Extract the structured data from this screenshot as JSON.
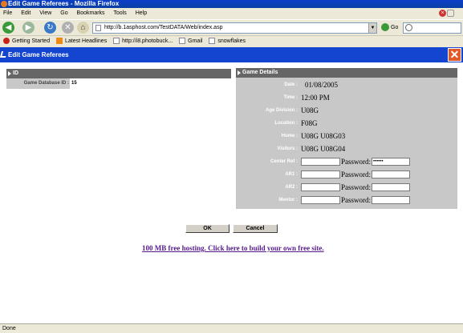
{
  "window": {
    "title": "Edit Game Referees - Mozilla Firefox"
  },
  "menu": [
    "File",
    "Edit",
    "View",
    "Go",
    "Bookmarks",
    "Tools",
    "Help"
  ],
  "nav": {
    "url": "http://b.1asphost.com/TestDATA/Web/index.asp",
    "go_label": "Go"
  },
  "bookmarks": [
    "Getting Started",
    "Latest Headlines",
    "http://i8.photobuck...",
    "Gmail",
    "snowflakes"
  ],
  "page": {
    "header": "Edit Game Referees",
    "id_section": {
      "title": "ID",
      "label": "Game Database ID :",
      "value": "15"
    },
    "details_section": {
      "title": "Game Details",
      "date_label": "Date :",
      "date": "01/08/2005",
      "time_label": "Time :",
      "time": "12:00 PM",
      "age_label": "Age Division :",
      "age": "U08G",
      "location_label": "Location :",
      "location": "F08G",
      "home_label": "Home :",
      "home": "U08G U08G03",
      "visitors_label": "Visitors :",
      "visitors": "U08G U08G04",
      "password_label": "Password:",
      "refs": [
        {
          "label": "Center Ref :",
          "name": "",
          "password": "••••••"
        },
        {
          "label": "AR1 :",
          "name": "",
          "password": ""
        },
        {
          "label": "AR2 :",
          "name": "",
          "password": ""
        },
        {
          "label": "Mentor :",
          "name": "",
          "password": ""
        }
      ]
    },
    "ok_label": "OK",
    "cancel_label": "Cancel",
    "hosting_link": "100 MB free hosting. Click here to build your own free site."
  },
  "status": "Done"
}
